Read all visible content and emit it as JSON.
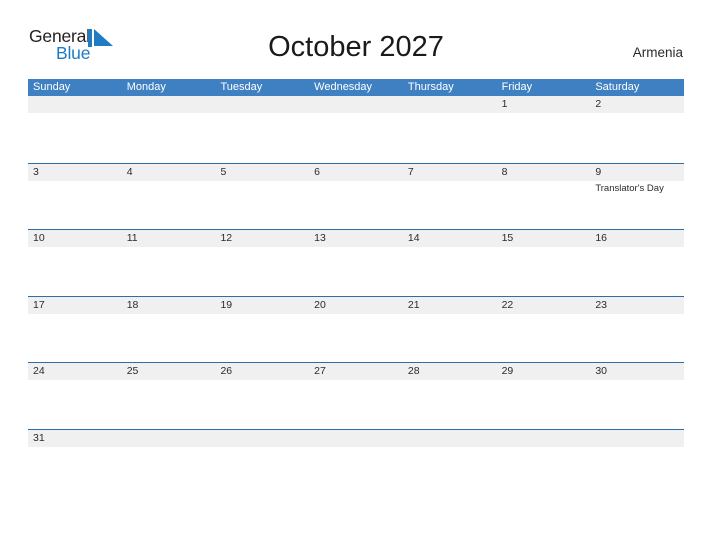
{
  "brand": {
    "name_part1": "General",
    "name_part2": "Blue",
    "accent_color": "#1e7bc4",
    "flag_icon": "triangle-flag-icon"
  },
  "header": {
    "title": "October 2027",
    "region": "Armenia"
  },
  "theme": {
    "header_blue": "#3f80c2",
    "row_divider_blue": "#2e6ea8",
    "day_band_gray": "#f0f0f0",
    "text_dark": "#2b2b2b"
  },
  "calendar": {
    "weekdays": [
      "Sunday",
      "Monday",
      "Tuesday",
      "Wednesday",
      "Thursday",
      "Friday",
      "Saturday"
    ],
    "weeks": [
      [
        {
          "day": "",
          "event": ""
        },
        {
          "day": "",
          "event": ""
        },
        {
          "day": "",
          "event": ""
        },
        {
          "day": "",
          "event": ""
        },
        {
          "day": "",
          "event": ""
        },
        {
          "day": "1",
          "event": ""
        },
        {
          "day": "2",
          "event": ""
        }
      ],
      [
        {
          "day": "3",
          "event": ""
        },
        {
          "day": "4",
          "event": ""
        },
        {
          "day": "5",
          "event": ""
        },
        {
          "day": "6",
          "event": ""
        },
        {
          "day": "7",
          "event": ""
        },
        {
          "day": "8",
          "event": ""
        },
        {
          "day": "9",
          "event": "Translator's Day"
        }
      ],
      [
        {
          "day": "10",
          "event": ""
        },
        {
          "day": "11",
          "event": ""
        },
        {
          "day": "12",
          "event": ""
        },
        {
          "day": "13",
          "event": ""
        },
        {
          "day": "14",
          "event": ""
        },
        {
          "day": "15",
          "event": ""
        },
        {
          "day": "16",
          "event": ""
        }
      ],
      [
        {
          "day": "17",
          "event": ""
        },
        {
          "day": "18",
          "event": ""
        },
        {
          "day": "19",
          "event": ""
        },
        {
          "day": "20",
          "event": ""
        },
        {
          "day": "21",
          "event": ""
        },
        {
          "day": "22",
          "event": ""
        },
        {
          "day": "23",
          "event": ""
        }
      ],
      [
        {
          "day": "24",
          "event": ""
        },
        {
          "day": "25",
          "event": ""
        },
        {
          "day": "26",
          "event": ""
        },
        {
          "day": "27",
          "event": ""
        },
        {
          "day": "28",
          "event": ""
        },
        {
          "day": "29",
          "event": ""
        },
        {
          "day": "30",
          "event": ""
        }
      ],
      [
        {
          "day": "31",
          "event": ""
        },
        {
          "day": "",
          "event": ""
        },
        {
          "day": "",
          "event": ""
        },
        {
          "day": "",
          "event": ""
        },
        {
          "day": "",
          "event": ""
        },
        {
          "day": "",
          "event": ""
        },
        {
          "day": "",
          "event": ""
        }
      ]
    ]
  }
}
